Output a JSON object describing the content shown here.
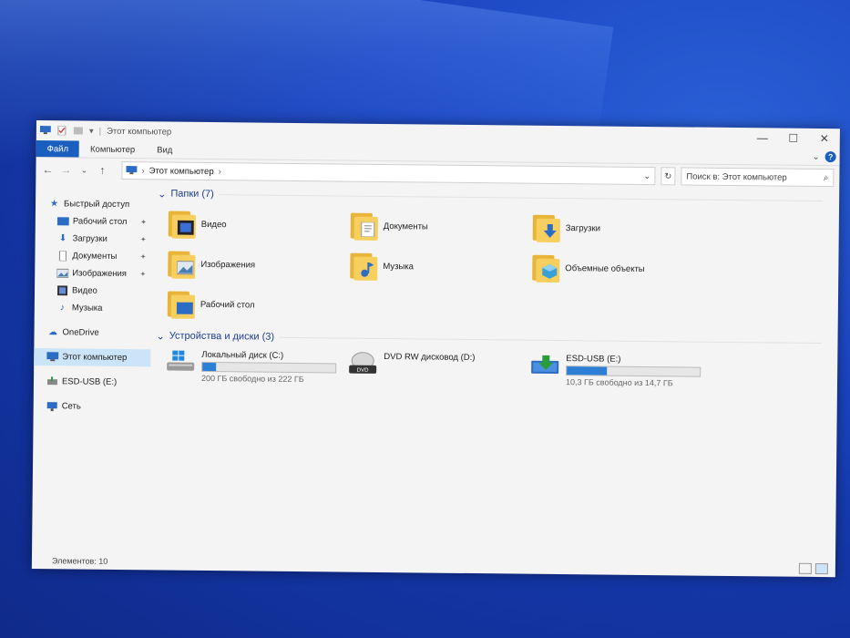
{
  "window": {
    "title": "Этот компьютер",
    "controls": {
      "minimize": "—",
      "maximize": "☐",
      "close": "✕"
    }
  },
  "ribbon": {
    "tabs": [
      "Файл",
      "Компьютер",
      "Вид"
    ],
    "expand": "⌄",
    "help": "?"
  },
  "nav": {
    "back": "←",
    "forward": "→",
    "history": "⌄",
    "up": "↑"
  },
  "address": {
    "breadcrumbs": [
      "Этот компьютер"
    ],
    "sep": "›",
    "dropdown": "⌄",
    "refresh": "↻"
  },
  "search": {
    "placeholder": "Поиск в: Этот компьютер",
    "icon": "⌕"
  },
  "sidebar": {
    "quick_access": "Быстрый доступ",
    "quick_items": [
      {
        "label": "Рабочий стол",
        "icon": "desktop-icon"
      },
      {
        "label": "Загрузки",
        "icon": "download-icon"
      },
      {
        "label": "Документы",
        "icon": "documents-icon"
      },
      {
        "label": "Изображения",
        "icon": "pictures-icon"
      },
      {
        "label": "Видео",
        "icon": "video-icon"
      },
      {
        "label": "Музыка",
        "icon": "music-icon"
      }
    ],
    "pin": "📌",
    "onedrive": "OneDrive",
    "this_pc": "Этот компьютер",
    "esd": "ESD-USB (E:)",
    "network": "Сеть"
  },
  "folders_group": {
    "title": "Папки (7)",
    "items": [
      {
        "label": "Видео",
        "icon": "video-folder-icon"
      },
      {
        "label": "Документы",
        "icon": "documents-folder-icon"
      },
      {
        "label": "Загрузки",
        "icon": "downloads-folder-icon"
      },
      {
        "label": "Изображения",
        "icon": "pictures-folder-icon"
      },
      {
        "label": "Музыка",
        "icon": "music-folder-icon"
      },
      {
        "label": "Объемные объекты",
        "icon": "3d-objects-folder-icon"
      },
      {
        "label": "Рабочий стол",
        "icon": "desktop-folder-icon"
      }
    ]
  },
  "drives_group": {
    "title": "Устройства и диски (3)",
    "items": [
      {
        "label": "Локальный диск (C:)",
        "free": "200 ГБ свободно из 222 ГБ",
        "used_fraction": 0.1
      },
      {
        "label": "DVD RW дисковод (D:)",
        "free": "",
        "used_fraction": null
      },
      {
        "label": "ESD-USB (E:)",
        "free": "10,3 ГБ свободно из 14,7 ГБ",
        "used_fraction": 0.3
      }
    ],
    "dvd_badge": "DVD"
  },
  "status": {
    "items": "Элементов: 10"
  },
  "colors": {
    "accent": "#1a5fbf",
    "bar_fill": "#2d7fd6",
    "selected": "#cce4f7",
    "folder": "#f6cf5e"
  }
}
